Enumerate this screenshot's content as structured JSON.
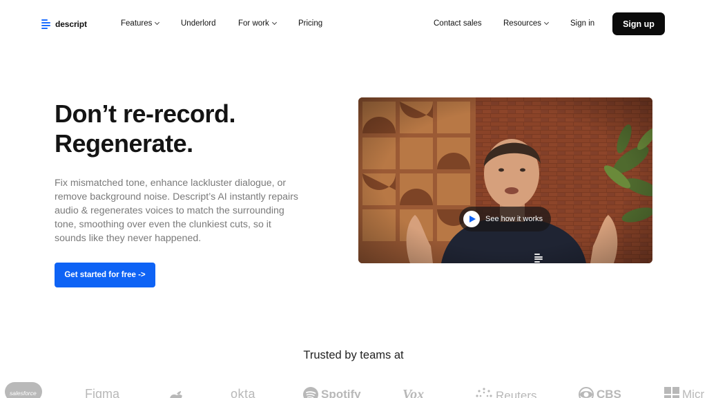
{
  "nav": {
    "brand": "descript",
    "links": [
      {
        "label": "Features",
        "has_dropdown": true
      },
      {
        "label": "Underlord",
        "has_dropdown": false
      },
      {
        "label": "For work",
        "has_dropdown": true
      },
      {
        "label": "Pricing",
        "has_dropdown": false
      }
    ],
    "right": {
      "contact": "Contact sales",
      "resources": "Resources",
      "signin": "Sign in",
      "signup": "Sign up"
    }
  },
  "hero": {
    "headline_line1": "Don’t re-record.",
    "headline_line2": "Regenerate.",
    "description": "Fix mismatched tone, enhance lackluster dialogue, or remove background noise. Descript’s AI instantly repairs audio & regenerates voices to match the surrounding tone, smoothing over even the clunkiest cuts, so it sounds like they never happened.",
    "cta": "Get started for free ->"
  },
  "video": {
    "button_label": "See how it works",
    "icons": [
      "play-icon",
      "descript-watermark-icon"
    ]
  },
  "trusted": {
    "heading": "Trusted by teams at",
    "logos": [
      "salesforce",
      "Figma",
      "apple-icon",
      "okta",
      "Spotify",
      "Vox",
      "Reuters",
      "CBS",
      "Micr"
    ]
  },
  "colors": {
    "accent": "#0e63f5",
    "logo_blue": "#1a6cff",
    "signup_bg": "#0b0b0b",
    "body_text_muted": "#7a7a7a",
    "logo_gray": "#b8b8b8"
  }
}
